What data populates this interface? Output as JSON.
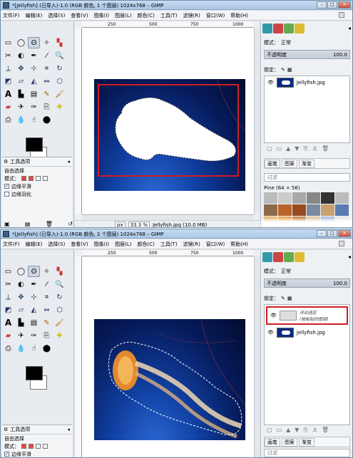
{
  "windows": [
    {
      "title": "*[Jellyfish] (已导入)-1.0 (RGB 颜色, 1 个图层) 1024x768 – GIMP",
      "menu": [
        "文件(F)",
        "编辑(E)",
        "选择(S)",
        "查看(V)",
        "图像(I)",
        "图层(L)",
        "颜色(C)",
        "工具(T)",
        "滤镜(R)",
        "窗口(W)",
        "帮助(H)"
      ],
      "ruler_marks": [
        "250",
        "500",
        "750",
        "1000"
      ],
      "tool_options": {
        "title": "工具选项",
        "tool_name": "自由选择",
        "mode_label": "模式：",
        "antialias_label": "边缘平滑",
        "feather_label": "边缘羽化"
      },
      "status": {
        "unit": "px",
        "zoom": "33.3 %",
        "file": "Jellyfish.jpg (10.0 MB)"
      },
      "layers_panel": {
        "mode_label": "模式：",
        "mode_value": "正常",
        "opacity_label": "不透明度",
        "opacity_value": "100.0",
        "lock_label": "锁定：",
        "layers": [
          {
            "name": "Jellyfish.jpg"
          }
        ]
      },
      "patterns": {
        "tabs": [
          "画笔",
          "图案",
          "渐变"
        ],
        "filter_placeholder": "过滤",
        "current": "Pine (64 × 56)"
      }
    },
    {
      "title": "*[Jellyfish] (已导入)-1.0 (RGB 颜色, 2 个图层) 1024x768 – GIMP",
      "menu": [
        "文件(F)",
        "编辑(E)",
        "选择(S)",
        "查看(V)",
        "图像(I)",
        "图层(L)",
        "颜色(C)",
        "工具(T)",
        "滤镜(R)",
        "窗口(W)",
        "帮助(H)"
      ],
      "ruler_marks": [
        "250",
        "500",
        "750",
        "1000"
      ],
      "tool_options": {
        "title": "工具选项",
        "tool_name": "自由选择",
        "mode_label": "模式：",
        "antialias_label": "边缘平滑"
      },
      "layers_panel": {
        "mode_label": "模式：",
        "mode_value": "正常",
        "opacity_label": "不透明度",
        "opacity_value": "100.0",
        "lock_label": "锁定：",
        "layers": [
          {
            "name": "浮动选区\n(被粘贴的图层)"
          },
          {
            "name": "Jellyfish.jpg"
          }
        ]
      },
      "patterns": {
        "tabs": [
          "画笔",
          "图案",
          "渐变"
        ],
        "filter_placeholder": "过滤",
        "current": "Pine (64 × 56)"
      }
    }
  ],
  "colors": {
    "highlight": "#d01c24",
    "canvas_blue": "#0b2a80"
  }
}
